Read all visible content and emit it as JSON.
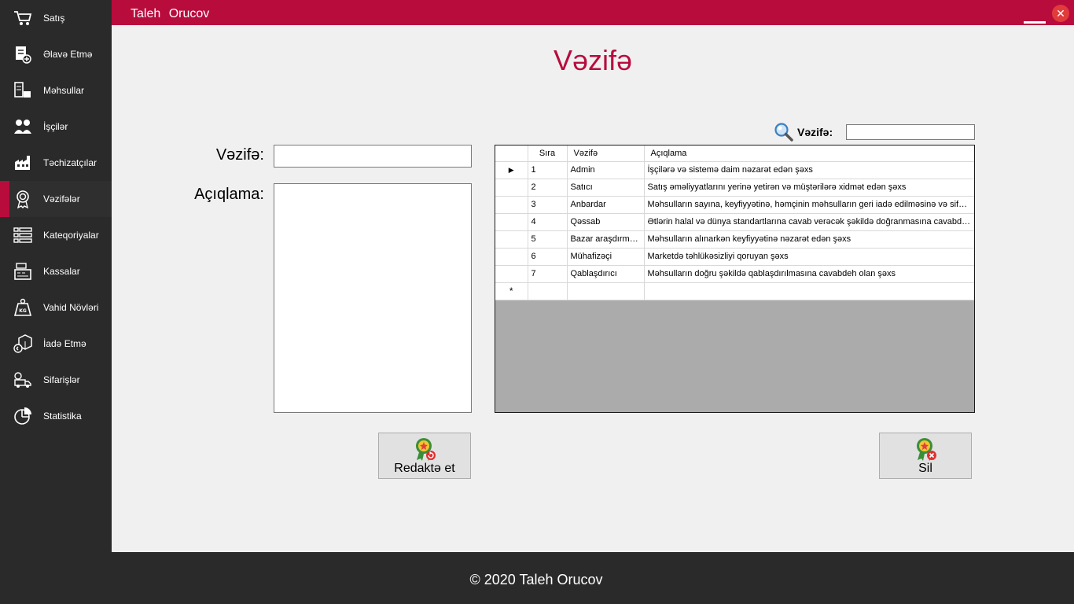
{
  "sidebar": {
    "items": [
      {
        "label": "Satış",
        "icon": "cart-icon"
      },
      {
        "label": "Əlavə Etmə",
        "icon": "add-document-icon"
      },
      {
        "label": "Məhsullar",
        "icon": "products-icon"
      },
      {
        "label": "İşçilər",
        "icon": "workers-icon"
      },
      {
        "label": "Təchizatçılar",
        "icon": "suppliers-icon"
      },
      {
        "label": "Vəzifələr",
        "icon": "badge-icon"
      },
      {
        "label": "Kateqoriyalar",
        "icon": "list-icon"
      },
      {
        "label": "Kassalar",
        "icon": "cash-register-icon"
      },
      {
        "label": "Vahid Növləri",
        "icon": "weight-icon"
      },
      {
        "label": "İadə Etmə",
        "icon": "return-box-icon"
      },
      {
        "label": "Sifarişlər",
        "icon": "delivery-icon"
      },
      {
        "label": "Statistika",
        "icon": "pie-chart-icon"
      }
    ],
    "active_index": 5
  },
  "titlebar": {
    "user": "Taleh  Orucov",
    "close": "✕"
  },
  "page": {
    "title": "Vəzifə"
  },
  "form": {
    "vezife_label": "Vəzifə:",
    "vezife_value": "",
    "aciqlama_label": "Açıqlama:",
    "aciqlama_value": ""
  },
  "search": {
    "label": "Vəzifə:",
    "value": ""
  },
  "grid": {
    "columns": [
      "Sıra",
      "Vəzifə",
      "Açıqlama"
    ],
    "current_row_marker": "▶",
    "new_row_marker": "*",
    "rows": [
      {
        "sira": "1",
        "vezife": "Admin",
        "aciqlama": "İşçilərə və sistemə daim nəzarət edən şəxs"
      },
      {
        "sira": "2",
        "vezife": "Satıcı",
        "aciqlama": "Satış əməliyyatlarını yerinə yetirən və müştərilərə xidmət edən şəxs"
      },
      {
        "sira": "3",
        "vezife": "Anbardar",
        "aciqlama": "Məhsulların sayına, keyfiyyətinə, həmçinin məhsulların geri iadə edilməsinə və sifarişləri..."
      },
      {
        "sira": "4",
        "vezife": "Qəssab",
        "aciqlama": "Ətlərin halal və dünya standartlarına cavab verəcək şəkildə doğranmasına cavabdeh ..."
      },
      {
        "sira": "5",
        "vezife": "Bazar araşdırmacısı",
        "aciqlama": "Məhsulların alınarkən keyfiyyətinə nəzarət edən şəxs"
      },
      {
        "sira": "6",
        "vezife": "Mühafizəçi",
        "aciqlama": "Marketdə təhlükəsizliyi qoruyan şəxs"
      },
      {
        "sira": "7",
        "vezife": "Qablaşdırıcı",
        "aciqlama": "Məhsulların doğru şəkildə qablaşdırılmasına cavabdeh olan şəxs"
      }
    ]
  },
  "buttons": {
    "edit_label": "Redaktə et",
    "delete_label": "Sil"
  },
  "footer": {
    "text": "© 2020 Taleh Orucov"
  },
  "colors": {
    "accent": "#b80c3d",
    "sidebar_bg": "#2a2a2a",
    "main_bg": "#f0f0f0"
  }
}
